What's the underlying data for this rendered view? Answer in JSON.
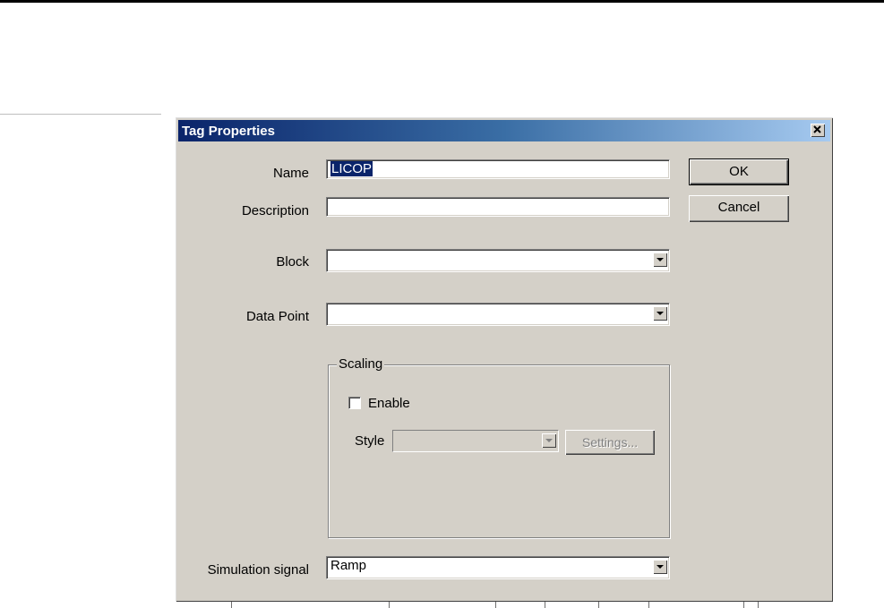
{
  "dialog": {
    "title": "Tag Properties",
    "close_label": "×"
  },
  "labels": {
    "name": "Name",
    "description": "Description",
    "block": "Block",
    "data_point": "Data Point",
    "simulation_signal": "Simulation signal"
  },
  "fields": {
    "name_value": "LICOP",
    "description_value": "",
    "block_value": "",
    "data_point_value": "",
    "simulation_signal_value": "Ramp"
  },
  "buttons": {
    "ok": "OK",
    "cancel": "Cancel",
    "settings": "Settings..."
  },
  "scaling": {
    "legend": "Scaling",
    "enable_label": "Enable",
    "enable_checked": false,
    "style_label": "Style",
    "style_value": ""
  },
  "colors": {
    "titlebar_start": "#0a246a",
    "titlebar_end": "#a6caf0",
    "dialog_bg": "#d4d0c8"
  }
}
